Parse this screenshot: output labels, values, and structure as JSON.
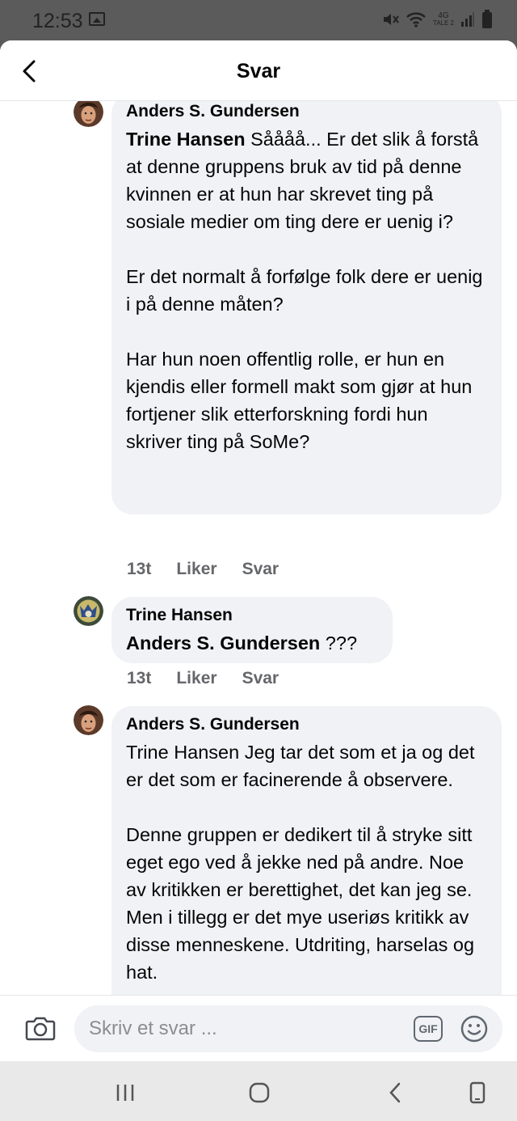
{
  "status_bar": {
    "time": "12:53",
    "network": "4G",
    "network_sub": "TALE 2"
  },
  "header": {
    "title": "Svar"
  },
  "comments": [
    {
      "author": "Anders S. Gundersen",
      "mention": "Trine Hansen",
      "text": " Såååå... Er det slik å forstå at denne gruppens bruk av tid på denne kvinnen er at hun har skrevet ting på sosiale medier om ting dere er uenig i?\n\nEr det normalt å forfølge folk dere er uenig i på denne måten?\n\nHar hun noen offentlig rolle, er hun en kjendis eller formell makt som gjør at hun fortjener slik etterforskning fordi hun skriver ting på SoMe?",
      "time": "13t",
      "like_label": "Liker",
      "reply_label": "Svar"
    },
    {
      "author": "Trine Hansen",
      "mention": "Anders S. Gundersen",
      "text": " ???",
      "time": "13t",
      "like_label": "Liker",
      "reply_label": "Svar"
    },
    {
      "author": "Anders S. Gundersen",
      "mention": "",
      "text": "Trine Hansen Jeg tar det som et ja og det er det som er facinerende å observere.\n\nDenne gruppen er dedikert til å stryke sitt eget ego ved å jekke ned på andre. Noe av kritikken er berettighet, det kan jeg se. Men i tillegg er det mye useriøs kritikk av disse menneskene. Utdriting, harselas og hat."
    }
  ],
  "composer": {
    "placeholder": "Skriv et svar ...",
    "gif_label": "GIF"
  },
  "icons": {
    "back": "chevron-left-icon",
    "camera": "camera-icon",
    "emoji": "smiley-icon",
    "nav_recent": "recent-apps-icon",
    "nav_home": "home-icon",
    "nav_back": "back-icon",
    "nav_rotate": "rotate-icon"
  },
  "colors": {
    "bubble": "#f0f2f5",
    "meta": "#65676b",
    "text": "#050505"
  }
}
